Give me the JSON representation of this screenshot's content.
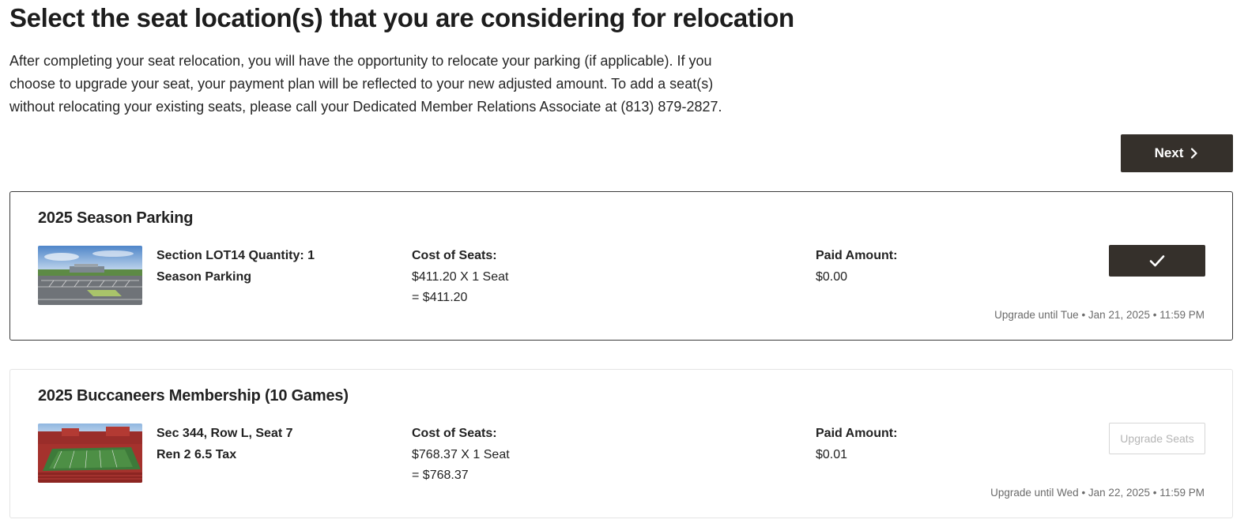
{
  "header": {
    "title": "Select the seat location(s) that you are considering for relocation",
    "intro": "After completing your seat relocation, you will have the opportunity to relocate your parking (if applicable). If you choose to upgrade your seat, your payment plan will be reflected to your new adjusted amount. To add a seat(s) without relocating your existing seats, please call your Dedicated Member Relations Associate at (813) 879-2827."
  },
  "actions": {
    "next_label": "Next",
    "next_icon": "chevron-right-icon"
  },
  "items": [
    {
      "title": "2025 Season Parking",
      "image": "parking-lot-thumbnail",
      "seat_line1": "Section LOT14 Quantity: 1",
      "seat_line2": "Season Parking",
      "cost_label": "Cost of Seats:",
      "cost_line1": "$411.20 X 1 Seat",
      "cost_line2": "= $411.20",
      "paid_label": "Paid Amount:",
      "paid_value": "$0.00",
      "action": "selected",
      "action_icon": "checkmark-icon",
      "deadline": "Upgrade until Tue • Jan 21, 2025 • 11:59 PM"
    },
    {
      "title": "2025 Buccaneers Membership (10 Games)",
      "image": "stadium-thumbnail",
      "seat_line1": "Sec 344, Row L, Seat 7",
      "seat_line2": "Ren 2 6.5 Tax",
      "cost_label": "Cost of Seats:",
      "cost_line1": "$768.37 X 1 Seat",
      "cost_line2": "= $768.37",
      "paid_label": "Paid Amount:",
      "paid_value": "$0.01",
      "action": "upgrade",
      "action_label": "Upgrade Seats",
      "deadline": "Upgrade until Wed • Jan 22, 2025 • 11:59 PM"
    }
  ],
  "colors": {
    "primary_button": "#35302b",
    "selected_border": "#3a3a3a",
    "muted_text": "#6b6b6b",
    "disabled_text": "#b5b5b5"
  }
}
